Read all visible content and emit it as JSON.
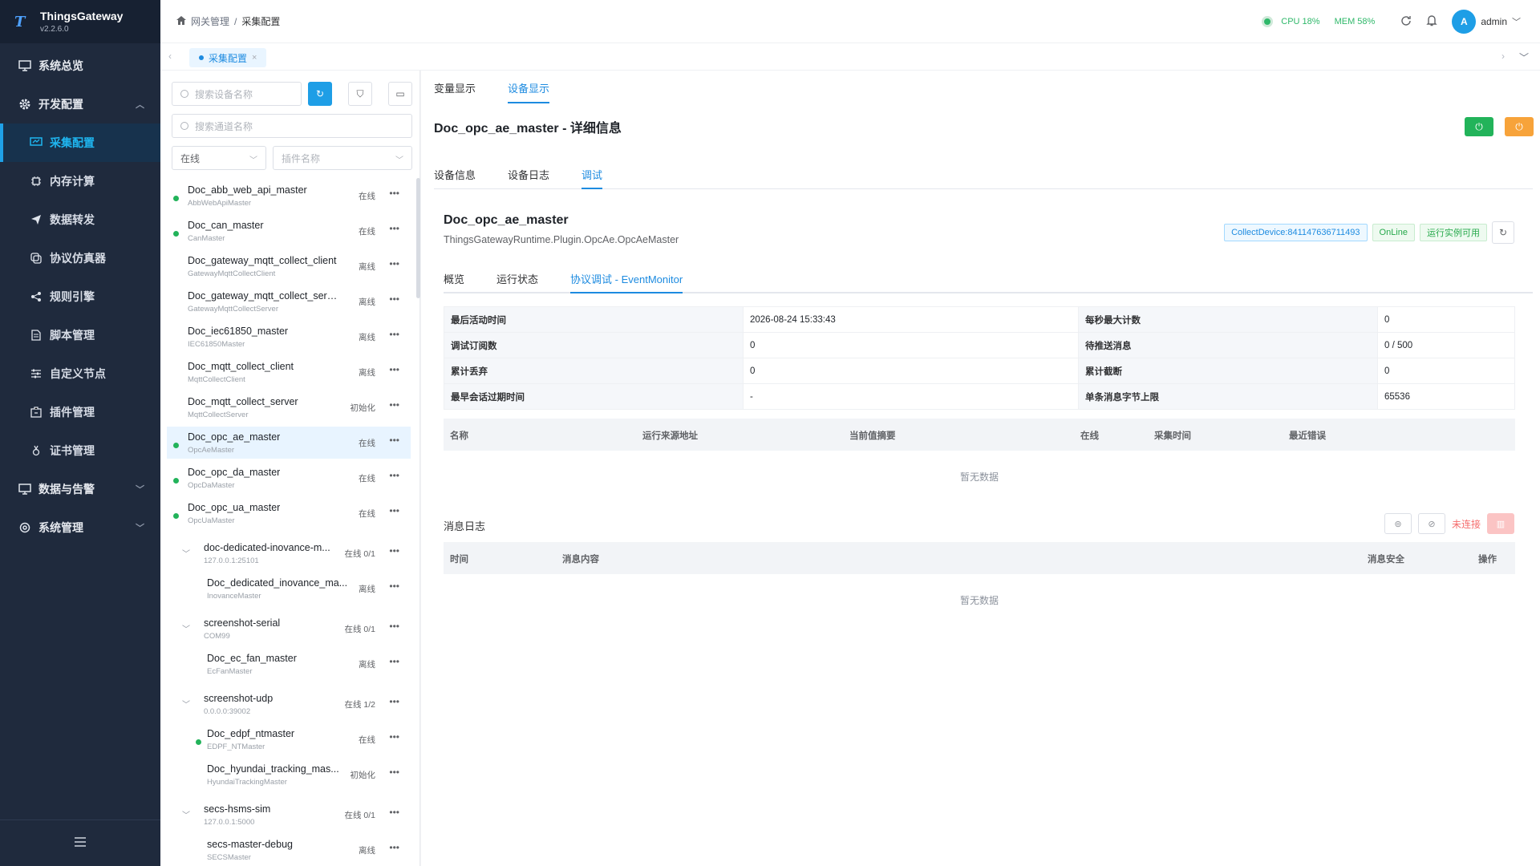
{
  "brand": {
    "name": "ThingsGateway",
    "version": "v2.2.6.0"
  },
  "sidebar": {
    "items": [
      {
        "label": "系统总览"
      },
      {
        "label": "开发配置"
      },
      {
        "label": "采集配置"
      },
      {
        "label": "内存计算"
      },
      {
        "label": "数据转发"
      },
      {
        "label": "协议仿真器"
      },
      {
        "label": "规则引擎"
      },
      {
        "label": "脚本管理"
      },
      {
        "label": "自定义节点"
      },
      {
        "label": "插件管理"
      },
      {
        "label": "证书管理"
      },
      {
        "label": "数据与告警"
      },
      {
        "label": "系统管理"
      }
    ]
  },
  "header": {
    "breadcrumb": [
      "网关管理",
      "/",
      "采集配置"
    ],
    "cpu": "CPU 18%",
    "mem": "MEM 58%",
    "user": "admin",
    "avatar_letter": "A"
  },
  "tabs": {
    "active": "采集配置"
  },
  "left": {
    "search_device_placeholder": "搜索设备名称",
    "search_channel_placeholder": "搜索通道名称",
    "status_filter": "在线",
    "plugin_filter_placeholder": "插件名称",
    "devices": [
      {
        "name": "Doc_abb_web_api_master",
        "sub": "AbbWebApiMaster",
        "status": "在线",
        "online": true
      },
      {
        "name": "Doc_can_master",
        "sub": "CanMaster",
        "status": "在线",
        "online": true
      },
      {
        "name": "Doc_gateway_mqtt_collect_client",
        "sub": "GatewayMqttCollectClient",
        "status": "离线",
        "online": false
      },
      {
        "name": "Doc_gateway_mqtt_collect_server",
        "sub": "GatewayMqttCollectServer",
        "status": "离线",
        "online": false
      },
      {
        "name": "Doc_iec61850_master",
        "sub": "IEC61850Master",
        "status": "离线",
        "online": false
      },
      {
        "name": "Doc_mqtt_collect_client",
        "sub": "MqttCollectClient",
        "status": "离线",
        "online": false
      },
      {
        "name": "Doc_mqtt_collect_server",
        "sub": "MqttCollectServer",
        "status": "初始化",
        "online": false
      },
      {
        "name": "Doc_opc_ae_master",
        "sub": "OpcAeMaster",
        "status": "在线",
        "online": true
      },
      {
        "name": "Doc_opc_da_master",
        "sub": "OpcDaMaster",
        "status": "在线",
        "online": true
      },
      {
        "name": "Doc_opc_ua_master",
        "sub": "OpcUaMaster",
        "status": "在线",
        "online": true
      },
      {
        "name": "doc-dedicated-inovance-m...",
        "sub": "127.0.0.1:25101",
        "status": "在线 0/1"
      },
      {
        "name": "Doc_dedicated_inovance_ma...",
        "sub": "InovanceMaster",
        "status": "离线",
        "online": false
      },
      {
        "name": "screenshot-serial",
        "sub": "COM99",
        "status": "在线 0/1"
      },
      {
        "name": "Doc_ec_fan_master",
        "sub": "EcFanMaster",
        "status": "离线",
        "online": false
      },
      {
        "name": "screenshot-udp",
        "sub": "0.0.0.0:39002",
        "status": "在线 1/2"
      },
      {
        "name": "Doc_edpf_ntmaster",
        "sub": "EDPF_NTMaster",
        "status": "在线",
        "online": true
      },
      {
        "name": "Doc_hyundai_tracking_mas...",
        "sub": "HyundaiTrackingMaster",
        "status": "初始化",
        "online": false
      },
      {
        "name": "secs-hsms-sim",
        "sub": "127.0.0.1:5000",
        "status": "在线 0/1"
      },
      {
        "name": "secs-master-debug",
        "sub": "SECSMaster",
        "status": "离线",
        "online": false
      }
    ]
  },
  "right": {
    "top_tabs": [
      "变量显示",
      "设备显示"
    ],
    "title": "Doc_opc_ae_master - 详细信息",
    "sub_tabs": [
      "设备信息",
      "设备日志",
      "调试"
    ],
    "device_name": "Doc_opc_ae_master",
    "plugin": "ThingsGatewayRuntime.Plugin.OpcAe.OpcAeMaster",
    "tags": {
      "collect": "CollectDevice:841147636711493",
      "online": "OnLine",
      "runtime": "运行实例可用"
    },
    "inner_tabs": [
      "概览",
      "运行状态",
      "协议调试 - EventMonitor"
    ],
    "kv": {
      "last_active_label": "最后活动时间",
      "last_active": "2026-08-24 15:33:43",
      "max_per_sec_label": "每秒最大计数",
      "max_per_sec": "0",
      "debug_sub_label": "调试订阅数",
      "debug_sub": "0",
      "pending_label": "待推送消息",
      "pending": "0 / 500",
      "dropped_label": "累计丢弃",
      "dropped": "0",
      "truncated_label": "累计截断",
      "truncated": "0",
      "expire_label": "最早会话过期时间",
      "expire": "-",
      "max_bytes_label": "单条消息字节上限",
      "max_bytes": "65536"
    },
    "table1": {
      "cols": [
        "名称",
        "运行来源地址",
        "当前值摘要",
        "在线",
        "采集时间",
        "最近错误"
      ],
      "empty": "暂无数据"
    },
    "log": {
      "label": "消息日志",
      "status": "未连接"
    },
    "table2": {
      "cols": [
        "时间",
        "消息内容",
        "消息安全",
        "操作"
      ],
      "empty": "暂无数据"
    }
  }
}
